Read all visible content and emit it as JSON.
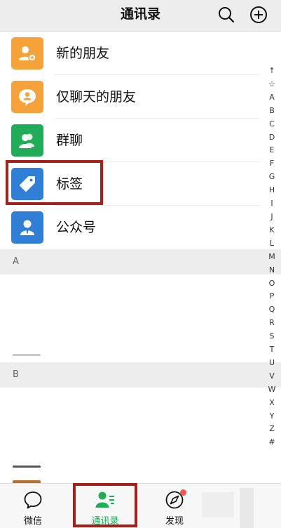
{
  "header": {
    "title": "通讯录",
    "search_icon": "search-icon",
    "add_icon": "plus-circle-icon"
  },
  "entries": [
    {
      "label": "新的朋友",
      "icon": "add-friend-icon",
      "color": "#f5a23a"
    },
    {
      "label": "仅聊天的朋友",
      "icon": "chat-only-friend-icon",
      "color": "#f5a23a"
    },
    {
      "label": "群聊",
      "icon": "group-chat-icon",
      "color": "#21ad58"
    },
    {
      "label": "标签",
      "icon": "tag-icon",
      "color": "#2f7fd6"
    },
    {
      "label": "公众号",
      "icon": "official-account-icon",
      "color": "#2f7fd6"
    }
  ],
  "sections": [
    {
      "letter": "A"
    },
    {
      "letter": "B"
    }
  ],
  "index_letters": [
    "↑",
    "☆",
    "A",
    "B",
    "C",
    "D",
    "E",
    "F",
    "G",
    "H",
    "I",
    "J",
    "K",
    "L",
    "M",
    "N",
    "O",
    "P",
    "Q",
    "R",
    "S",
    "T",
    "U",
    "V",
    "W",
    "X",
    "Y",
    "Z",
    "#"
  ],
  "tabs": [
    {
      "label": "微信",
      "icon": "chat-bubble-icon"
    },
    {
      "label": "通讯录",
      "icon": "contacts-icon",
      "active": true
    },
    {
      "label": "发现",
      "icon": "compass-icon"
    }
  ],
  "colors": {
    "accent": "#21ad58",
    "highlight": "#a8201a",
    "badge": "#f25353"
  }
}
